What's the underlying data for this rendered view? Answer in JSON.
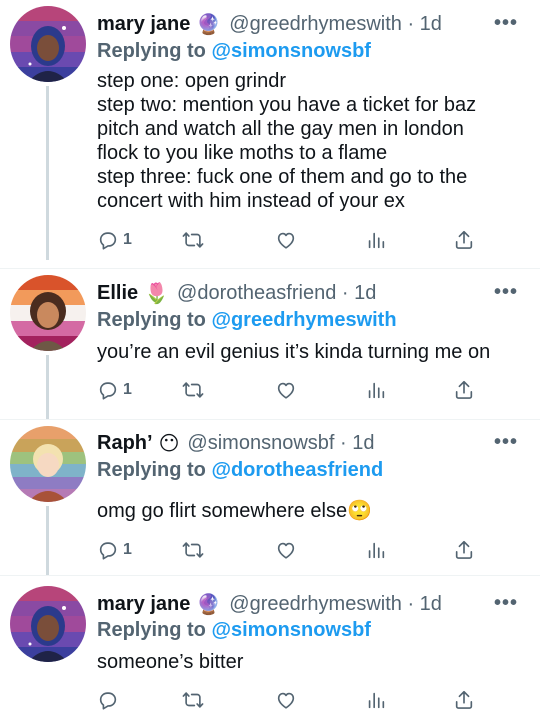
{
  "tweets": [
    {
      "name": "mary jane",
      "emoji": "🔮",
      "handle_time": "@greedrhymeswith · 1d",
      "replying_prefix": "Replying to",
      "replying_to": "@simonsnowsbf",
      "lines": [
        "step one: open grindr",
        "step two: mention you have a ticket for baz",
        "pitch and watch all the gay men in london",
        "flock to you like moths to a flame",
        "step three: fuck one of them and go to the",
        "concert with him instead of your ex"
      ],
      "reply_count": "1",
      "more": "•••"
    },
    {
      "name": "Ellie",
      "emoji": "🌷",
      "handle_time": "@dorotheasfriend · 1d",
      "replying_prefix": "Replying to",
      "replying_to": "@greedrhymeswith",
      "lines": [
        "you’re an evil genius it’s kinda turning me on"
      ],
      "reply_count": "1",
      "more": "•••"
    },
    {
      "name": "Raph’",
      "emoji": "😶",
      "handle_time": "@simonsnowsbf · 1d",
      "replying_prefix": "Replying to",
      "replying_to": "@dorotheasfriend",
      "lines": [
        "omg go flirt somewhere else🙄"
      ],
      "reply_count": "1",
      "more": "•••"
    },
    {
      "name": "mary jane",
      "emoji": "🔮",
      "handle_time": "@greedrhymeswith · 1d",
      "replying_prefix": "Replying to",
      "replying_to": "@simonsnowsbf",
      "lines": [
        "someone’s bitter"
      ],
      "reply_count": "",
      "more": "•••"
    }
  ],
  "icons": {
    "reply": "reply-icon",
    "retweet": "retweet-icon",
    "like": "heart-icon",
    "views": "views-icon",
    "share": "share-icon"
  },
  "colors": {
    "link": "#1d9bf0",
    "secondary": "#536471",
    "text": "#0f1419"
  }
}
